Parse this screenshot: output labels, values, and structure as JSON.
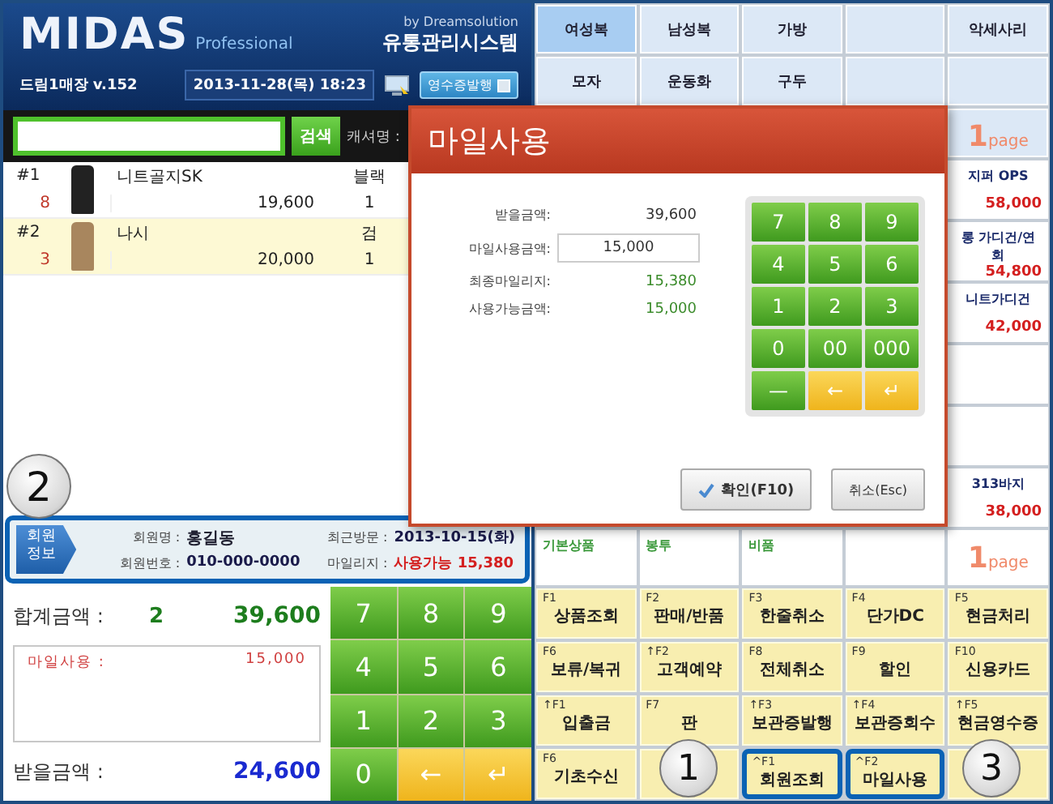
{
  "header": {
    "logo": "MIDAS",
    "logo_sub": "Professional",
    "vendor": "by Dreamsolution",
    "system_name": "유통관리시스템",
    "store": "드림1매장 v.152",
    "datetime": "2013-11-28(목) 18:23",
    "receipt_button": {
      "label": "영수증발행",
      "checked": false
    }
  },
  "search": {
    "button": "검색",
    "cashier_label": "캐셔명 :"
  },
  "items": [
    {
      "number": "#1",
      "stock": "8",
      "name": "니트골지SK",
      "price": "19,600",
      "variant": "블랙",
      "quantity": "1",
      "selected": false
    },
    {
      "number": "#2",
      "stock": "3",
      "name": "나시",
      "price": "20,000",
      "variant": "검",
      "quantity": "1",
      "selected": true
    }
  ],
  "member": {
    "badge": "회원 정보",
    "highlighted": true,
    "fields": [
      {
        "label": "회원명 :",
        "value": "홍길동",
        "kind": "name"
      },
      {
        "label": "최근방문 :",
        "value": "2013-10-15(화)",
        "kind": "plain"
      },
      {
        "label": "회원번호 :",
        "value": "010-000-0000",
        "kind": "plain"
      },
      {
        "label": "마일리지 :",
        "value": "사용가능 15,380",
        "kind": "alert"
      }
    ]
  },
  "totals": {
    "total_label": "합계금액 :",
    "count": "2",
    "total": "39,600",
    "mileage_label": "마일사용 :",
    "mileage": "15,000",
    "receive_label": "받을금액 :",
    "receive": "24,600"
  },
  "keypad": [
    {
      "label": "7",
      "kind": "digit"
    },
    {
      "label": "8",
      "kind": "digit"
    },
    {
      "label": "9",
      "kind": "digit"
    },
    {
      "label": "4",
      "kind": "digit"
    },
    {
      "label": "5",
      "kind": "digit"
    },
    {
      "label": "6",
      "kind": "digit"
    },
    {
      "label": "1",
      "kind": "digit"
    },
    {
      "label": "2",
      "kind": "digit"
    },
    {
      "label": "3",
      "kind": "digit"
    },
    {
      "label": "0",
      "kind": "digit"
    },
    {
      "label": "←",
      "kind": "action"
    },
    {
      "label": "↵",
      "kind": "action"
    }
  ],
  "categories": [
    {
      "label": "여성복",
      "selected": true
    },
    {
      "label": "남성복",
      "selected": false
    },
    {
      "label": "가방",
      "selected": false
    },
    {
      "selected": false
    },
    {
      "label": "악세사리",
      "selected": false
    },
    {
      "label": "모자",
      "selected": false
    },
    {
      "label": "운동화",
      "selected": false
    },
    {
      "label": "구두",
      "selected": false
    },
    {
      "selected": false
    },
    {
      "selected": false
    }
  ],
  "page_indicators": [
    {
      "number": "1",
      "unit": "page"
    },
    {
      "number": "1",
      "unit": "page"
    }
  ],
  "products": [
    {
      "kind": "product",
      "name": "지퍼 OPS",
      "price": "58,000"
    },
    {
      "kind": "product",
      "name": "롱 가디건/연회",
      "price": "54,800"
    },
    {
      "kind": "product",
      "name": "니트가디건",
      "price": "42,000"
    },
    {
      "kind": "empty"
    },
    {
      "kind": "empty"
    },
    {
      "kind": "product",
      "name": "313바지",
      "price": "38,000"
    }
  ],
  "sub_categories": [
    "기본상품",
    "봉투",
    "비품"
  ],
  "function_keys": [
    {
      "key": "F1",
      "label": "상품조회",
      "highlighted": false
    },
    {
      "key": "F2",
      "label": "판매/반품",
      "highlighted": false
    },
    {
      "key": "F3",
      "label": "한줄취소",
      "highlighted": false
    },
    {
      "key": "F4",
      "label": "단가DC",
      "highlighted": false
    },
    {
      "key": "F5",
      "label": "현금처리",
      "highlighted": false
    },
    {
      "key": "F6",
      "label": "보류/복귀",
      "highlighted": false
    },
    {
      "key": "↑F2",
      "label": "고객예약",
      "highlighted": false
    },
    {
      "key": "F8",
      "label": "전체취소",
      "highlighted": false
    },
    {
      "key": "F9",
      "label": "할인",
      "highlighted": false
    },
    {
      "key": "F10",
      "label": "신용카드",
      "highlighted": false
    },
    {
      "key": "↑F1",
      "label": "입출금",
      "highlighted": false
    },
    {
      "key": "F7",
      "label": "판",
      "highlighted": false
    },
    {
      "key": "↑F3",
      "label": "보관증발행",
      "highlighted": false
    },
    {
      "key": "↑F4",
      "label": "보관증회수",
      "highlighted": false
    },
    {
      "key": "↑F5",
      "label": "현금영수증",
      "highlighted": false
    },
    {
      "key": "F6",
      "label": "기초수신",
      "highlighted": false
    },
    {
      "highlighted": false
    },
    {
      "key": "^F1",
      "label": "회원조회",
      "highlighted": true
    },
    {
      "key": "^F2",
      "label": "마일사용",
      "highlighted": true
    },
    {
      "highlighted": false
    }
  ],
  "dialog": {
    "title": "마일사용",
    "fields": [
      {
        "label": "받을금액:",
        "value": "39,600",
        "kind": "plain"
      },
      {
        "label": "마일사용금액:",
        "value": "15,000",
        "kind": "input"
      },
      {
        "label": "최종마일리지:",
        "value": "15,380",
        "kind": "accent"
      },
      {
        "label": "사용가능금액:",
        "value": "15,000",
        "kind": "accent"
      }
    ],
    "keypad": [
      {
        "label": "7",
        "kind": "digit"
      },
      {
        "label": "8",
        "kind": "digit"
      },
      {
        "label": "9",
        "kind": "digit"
      },
      {
        "label": "4",
        "kind": "digit"
      },
      {
        "label": "5",
        "kind": "digit"
      },
      {
        "label": "6",
        "kind": "digit"
      },
      {
        "label": "1",
        "kind": "digit"
      },
      {
        "label": "2",
        "kind": "digit"
      },
      {
        "label": "3",
        "kind": "digit"
      },
      {
        "label": "0",
        "kind": "digit"
      },
      {
        "label": "00",
        "kind": "digit"
      },
      {
        "label": "000",
        "kind": "digit"
      },
      {
        "label": "—",
        "kind": "digit"
      },
      {
        "label": "←",
        "kind": "action"
      },
      {
        "label": "↵",
        "kind": "action"
      }
    ],
    "confirm": "확인(F10)",
    "cancel": "취소(Esc)"
  },
  "callouts": [
    {
      "number": "1"
    },
    {
      "number": "2"
    },
    {
      "number": "3"
    }
  ]
}
